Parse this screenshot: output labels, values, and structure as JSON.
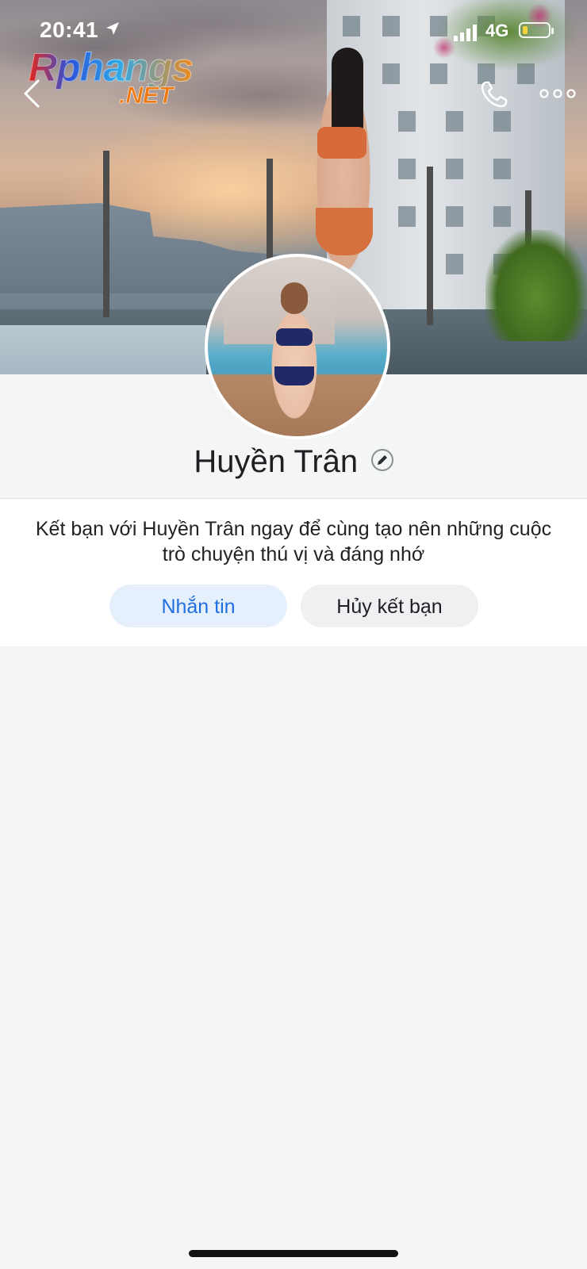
{
  "status_bar": {
    "time": "20:41",
    "network": "4G",
    "battery_level": 0.2,
    "battery_color": "#f2d33a"
  },
  "watermark": {
    "line1": "Rphangs",
    "line2": ".NET"
  },
  "nav": {
    "back_icon": "chevron-left-icon",
    "call_icon": "phone-icon",
    "more_icon": "more-dots-icon"
  },
  "profile": {
    "name": "Huyền Trân",
    "edit_icon": "pencil-icon"
  },
  "friend_prompt": {
    "text": "Kết bạn với Huyền Trân ngay để cùng tạo nên những cuộc trò chuyện thú vị và đáng nhớ"
  },
  "actions": {
    "message_label": "Nhắn tin",
    "unfriend_label": "Hủy kết bạn"
  },
  "colors": {
    "accent": "#1f6fe0",
    "accent_bg": "#e6f0fd",
    "secondary_bg": "#eef0f2",
    "page_bg": "#f4f5f5"
  }
}
